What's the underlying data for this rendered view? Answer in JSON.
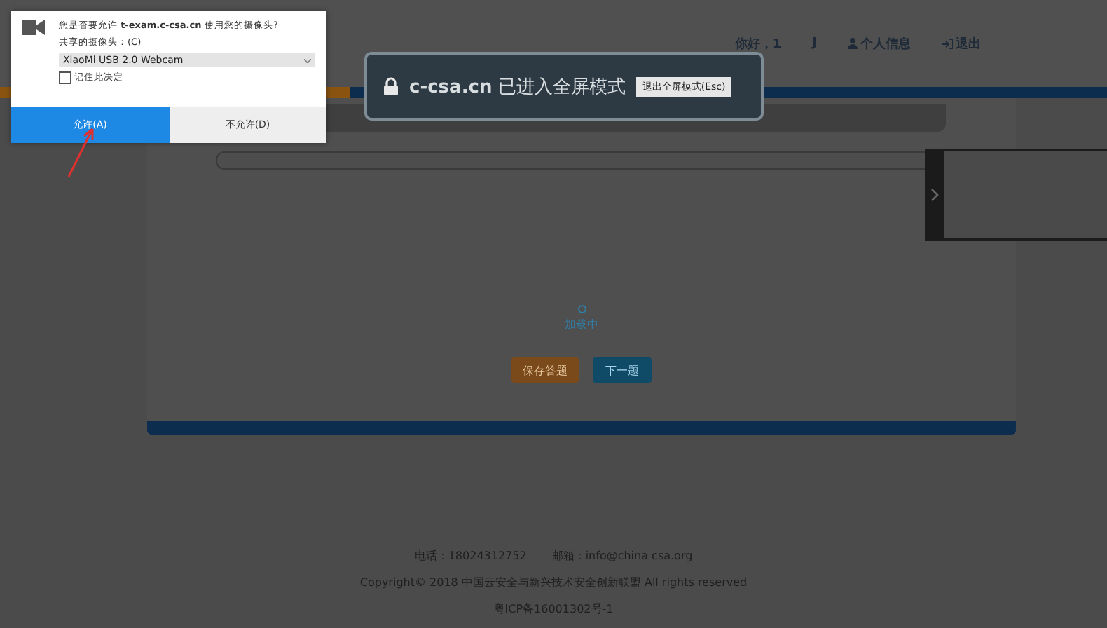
{
  "header": {
    "greeting": "你好，1",
    "user": "J",
    "profile_link": "个人信息",
    "logout_link": "退出"
  },
  "exam": {
    "loading": "加载中",
    "buttons": [
      {
        "label": "保存答题",
        "kind": "save"
      },
      {
        "label": "下一题",
        "kind": "next"
      }
    ]
  },
  "footer": {
    "phone": "电话：18024312752",
    "email": "邮箱：info@china csa.org",
    "copyright": "Copyright© 2018 中国云安全与新兴技术安全创新联盟 All rights reserved",
    "icp": "粤ICP备16001302号-1"
  },
  "camera_prompt": {
    "question_prefix": "您是否要允许",
    "site": "t-exam.c-csa.cn",
    "question_suffix": "使用您的摄像头?",
    "share_label": "共享的摄像头：(C)",
    "device": "XiaoMi USB 2.0 Webcam",
    "remember": {
      "label": "记住此决定",
      "checked": false
    },
    "buttons": [
      {
        "label": "允许(A)",
        "selected": true
      },
      {
        "label": "不允许(D)",
        "selected": false
      }
    ]
  },
  "fullscreen_notice": {
    "site": "c-csa.cn",
    "message": "已进入全屏模式",
    "exit_button": "退出全屏模式(Esc)"
  }
}
